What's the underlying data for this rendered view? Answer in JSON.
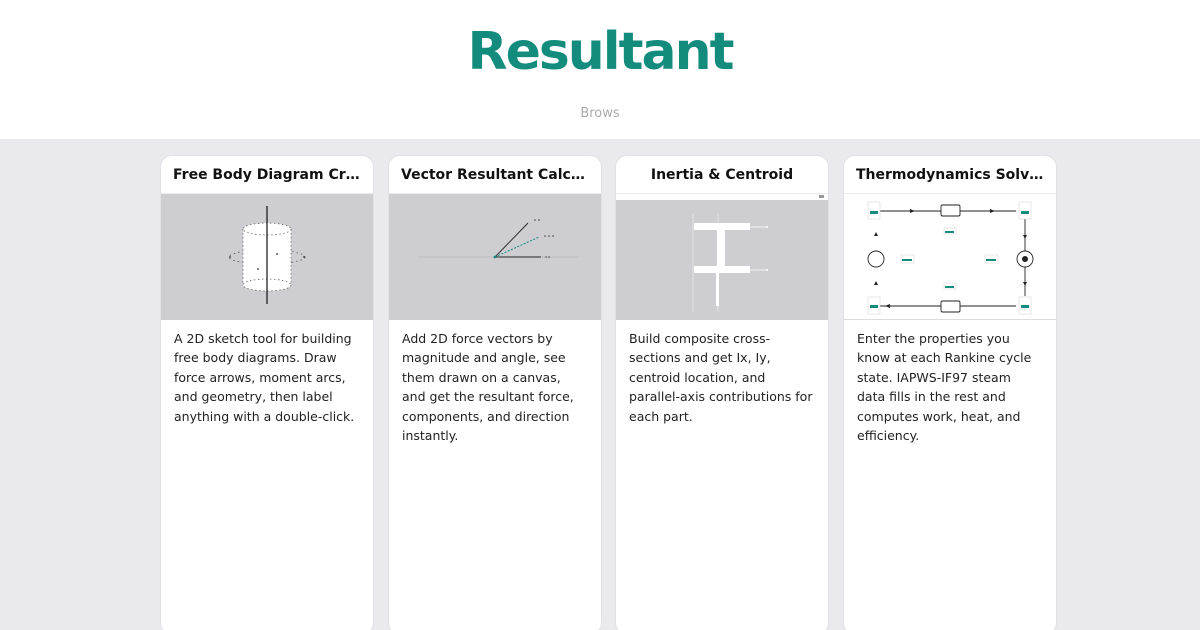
{
  "header": {
    "title": "Resultant",
    "subtitle": "Brows"
  },
  "cards": [
    {
      "title": "Free Body Diagram Creator",
      "description": "A 2D sketch tool for building free body diagrams. Draw force arrows, moment arcs, and geometry, then label anything with a double-click."
    },
    {
      "title": "Vector Resultant Calculator",
      "description": "Add 2D force vectors by magnitude and angle, see them drawn on a canvas, and get the resultant force, components, and direction instantly."
    },
    {
      "title": "Inertia & Centroid",
      "description": "Build composite cross-sections and get Ix, Iy, centroid location, and parallel-axis contributions for each part."
    },
    {
      "title": "Thermodynamics Solver",
      "description": "Enter the properties you know at each Rankine cycle state. IAPWS-IF97 steam data fills in the rest and computes work, heat, and efficiency."
    }
  ],
  "colors": {
    "accent": "#138b7d",
    "page_background": "#e9e9ee",
    "card_background": "#ffffff"
  }
}
